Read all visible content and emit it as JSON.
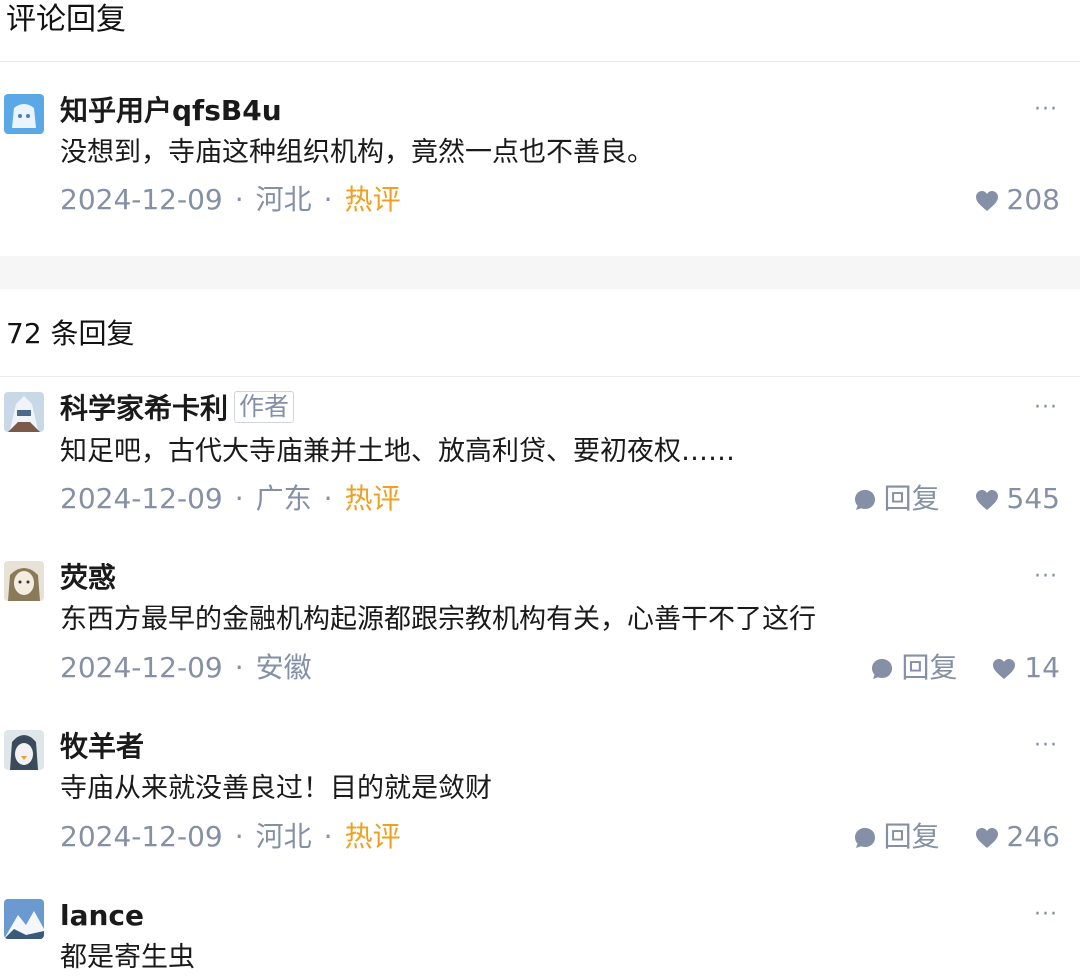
{
  "page": {
    "title": "评论回复",
    "replies_title": "72 条回复"
  },
  "colors": {
    "hot": "#f0a020",
    "meta": "#8590a6",
    "section_gap": "#f6f6f6"
  },
  "main_comment": {
    "author": "知乎用户qfsB4u",
    "content": "没想到，寺庙这种组织机构，竟然一点也不善良。",
    "date": "2024-12-09",
    "location": "河北",
    "hot_label": "热评",
    "likes": "208",
    "like_icon": "heart-icon",
    "more_icon": "more-dots-icon"
  },
  "replies": [
    {
      "author": "科学家希卡利",
      "badge": "作者",
      "content": "知足吧，古代大寺庙兼并土地、放高利贷、要初夜权……",
      "date": "2024-12-09",
      "location": "广东",
      "hot_label": "热评",
      "reply_label": "回复",
      "likes": "545"
    },
    {
      "author": "荧惑",
      "content": "东西方最早的金融机构起源都跟宗教机构有关，心善干不了这行",
      "date": "2024-12-09",
      "location": "安徽",
      "reply_label": "回复",
      "likes": "14"
    },
    {
      "author": "牧羊者",
      "content": "寺庙从来就没善良过！目的就是敛财",
      "date": "2024-12-09",
      "location": "河北",
      "hot_label": "热评",
      "reply_label": "回复",
      "likes": "246"
    },
    {
      "author": "lance",
      "content": "都是寄生虫"
    }
  ]
}
